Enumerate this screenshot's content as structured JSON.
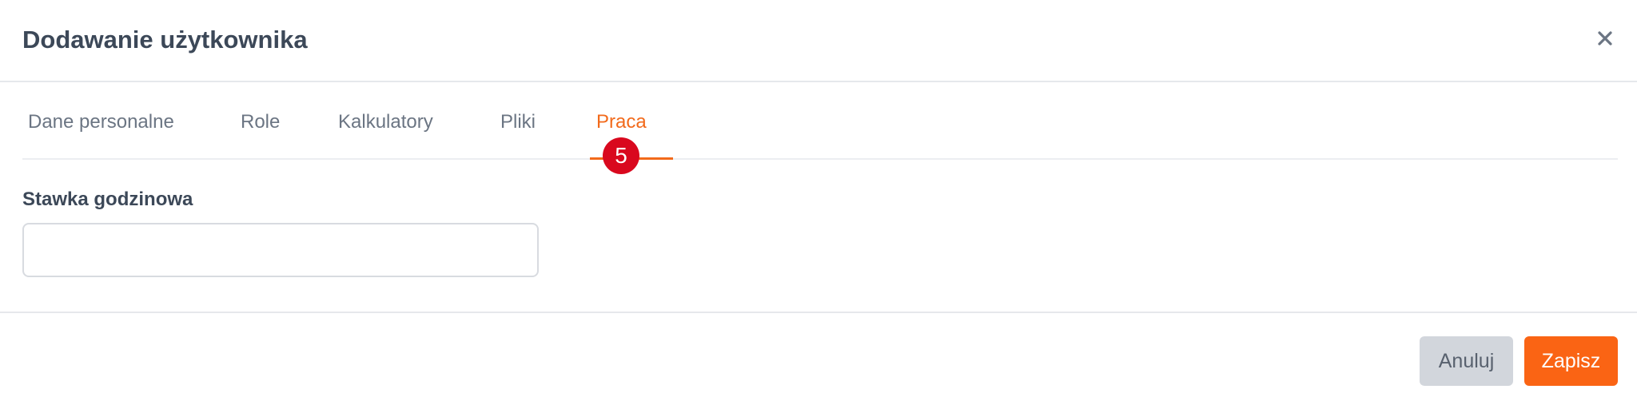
{
  "dialog": {
    "title": "Dodawanie użytkownika",
    "close_icon": "close-icon"
  },
  "tabs": [
    {
      "label": "Dane personalne",
      "active": false
    },
    {
      "label": "Role",
      "active": false
    },
    {
      "label": "Kalkulatory",
      "active": false
    },
    {
      "label": "Pliki",
      "active": false
    },
    {
      "label": "Praca",
      "active": true
    }
  ],
  "step_badge": "5",
  "form": {
    "hourly_rate": {
      "label": "Stawka godzinowa",
      "value": "",
      "placeholder": ""
    }
  },
  "footer": {
    "cancel_label": "Anuluj",
    "save_label": "Zapisz"
  },
  "colors": {
    "accent": "#f26a1b",
    "save_button": "#fa6414",
    "cancel_button": "#d2d6dc",
    "badge": "#d9081e"
  }
}
